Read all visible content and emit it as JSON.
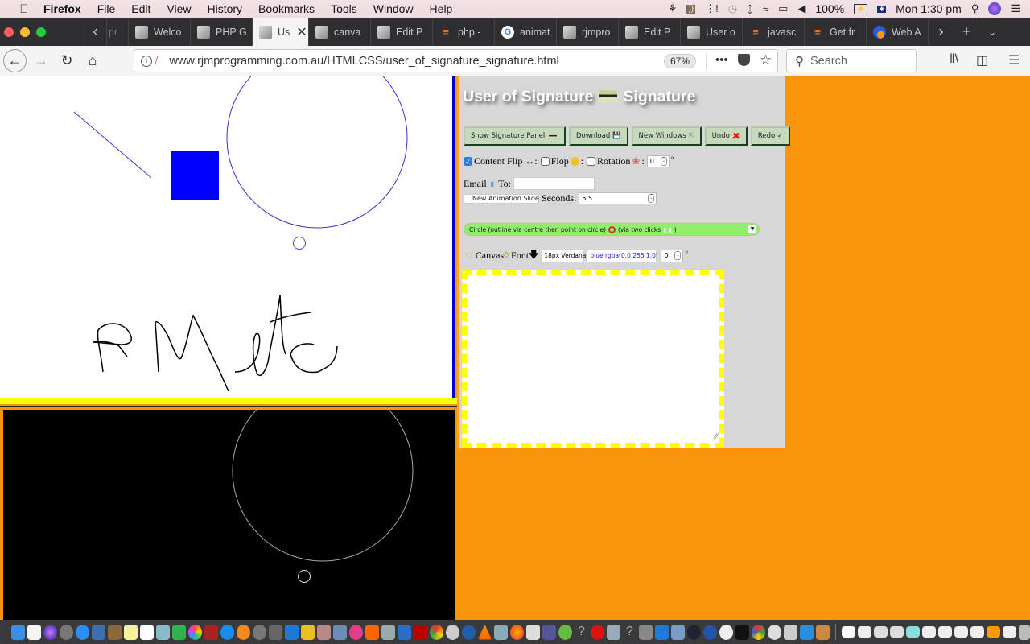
{
  "menubar": {
    "app": "Firefox",
    "items": [
      "File",
      "Edit",
      "View",
      "History",
      "Bookmarks",
      "Tools",
      "Window",
      "Help"
    ],
    "status": {
      "battery": "100%",
      "clock": "Mon 1:30 pm",
      "icons": [
        "avast-icon",
        "audio-hijack-icon",
        "activity-icon",
        "time-machine-icon",
        "bluetooth-icon",
        "wifi-icon",
        "airplay-icon",
        "volume-icon",
        "battery-icon",
        "flag-australia-icon",
        "spotlight-icon",
        "siri-icon",
        "notification-center-icon"
      ]
    }
  },
  "tabs": [
    {
      "label": "pr",
      "icon": "page-favicon"
    },
    {
      "label": "Welco",
      "icon": "page-favicon"
    },
    {
      "label": "PHP G",
      "icon": "page-favicon"
    },
    {
      "label": "Us",
      "icon": "page-favicon",
      "active": true
    },
    {
      "label": "canva",
      "icon": "page-favicon"
    },
    {
      "label": "Edit P",
      "icon": "page-favicon"
    },
    {
      "label": "php -",
      "icon": "stackoverflow-favicon"
    },
    {
      "label": "animat",
      "icon": "google-favicon"
    },
    {
      "label": "rjmpro",
      "icon": "page-favicon"
    },
    {
      "label": "Edit P",
      "icon": "page-favicon"
    },
    {
      "label": "User o",
      "icon": "page-favicon"
    },
    {
      "label": "javasc",
      "icon": "stackoverflow-favicon"
    },
    {
      "label": "Get fr",
      "icon": "stackoverflow-favicon"
    },
    {
      "label": "Web A",
      "icon": "web-favicon"
    }
  ],
  "navbar": {
    "url": "www.rjmprogramming.com.au/HTMLCSS/user_of_signature_signature.html",
    "zoom": "67%",
    "search_placeholder": "Search"
  },
  "page": {
    "title": "User of Signature",
    "title_suffix": "Signature",
    "buttons": {
      "show_panel": "Show Signature Panel",
      "download": "Download",
      "new_windows": "New Windows",
      "undo": "Undo",
      "redo": "Redo"
    },
    "options": {
      "content_flip_label": "Content Flip ↔:",
      "content_flip_checked": true,
      "flop_label": "Flop",
      "flop_checked": false,
      "rotation_label": "Rotation",
      "rotation_checked": false,
      "rotation_value": "0",
      "degree": "°"
    },
    "email": {
      "label": "Email",
      "to_label": "To:",
      "to_value": ""
    },
    "animation": {
      "new_slide_label": "New Animation Slide",
      "seconds_label": "Seconds:",
      "seconds_value": "5.5"
    },
    "mode_select": {
      "selected_text": "Circle (outline via centre then point on circle)",
      "selected_suffix": "(via two clicks",
      "selected_close": ")"
    },
    "text_tools": {
      "canvas_label": "Canvas",
      "font_label": "Font",
      "font_value": "18px Verdana",
      "color_value": "blue rgba(0,0,255,1.0)",
      "angle_value": "0",
      "degree": "°"
    },
    "colors": {
      "accent_orange": "#f7960d",
      "stroke_blue": "#0000ff",
      "dash_yellow": "#ffff00",
      "button_green": "#c6d9bd",
      "select_green": "#8fef6d"
    }
  },
  "dock": {
    "apps": [
      "finder",
      "text-edit",
      "siri",
      "launchpad",
      "safari",
      "preview",
      "notes-brown",
      "notes",
      "calendar",
      "photos-app",
      "facetime",
      "photos",
      "photo-booth",
      "app-store",
      "ibooks",
      "system-preferences",
      "gimp",
      "xcode",
      "wordpress",
      "script-editor",
      "image-capture",
      "itunes",
      "avast",
      "maps",
      "keynote",
      "filezilla",
      "chrome",
      "network-utility",
      "quicktime",
      "vlc",
      "virtualbox",
      "firefox",
      "mailer",
      "php",
      "android-studio",
      "unknown",
      "opera",
      "vagrant",
      "unknown",
      "automator",
      "vscode",
      "capture",
      "network-radar",
      "cyberduck",
      "github",
      "terminal",
      "anaconda",
      "drop",
      "preview-pdf",
      "files",
      "guitar"
    ],
    "recent_count": 11,
    "trash": "trash"
  }
}
